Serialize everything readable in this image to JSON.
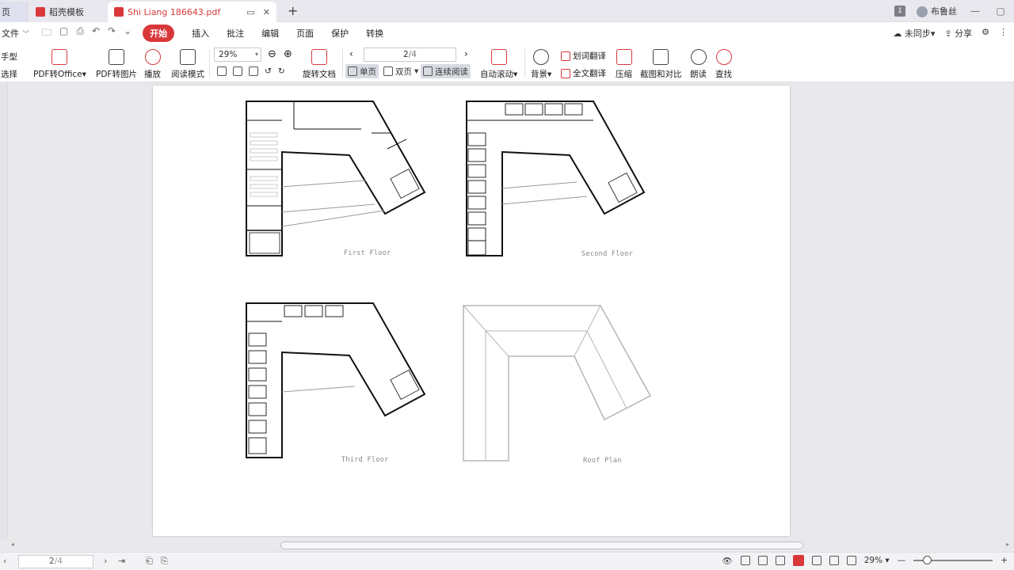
{
  "tabs": {
    "first": "页",
    "template": "稻壳模板",
    "document": "Shi Liang 186643.pdf"
  },
  "titlebar": {
    "badge": "1",
    "user": "布鲁丝"
  },
  "menu": {
    "file": "文件",
    "items": [
      "开始",
      "插入",
      "批注",
      "编辑",
      "页面",
      "保护",
      "转换"
    ],
    "sync": "未同步",
    "share": "分享"
  },
  "ribbon": {
    "hand_top": "手型",
    "hand_bottom": "选择",
    "pdf_to_office": "PDF转Office",
    "pdf_to_image": "PDF转图片",
    "play": "播放",
    "read_mode": "阅读模式",
    "zoom": "29%",
    "rotate": "旋转文档",
    "single": "单页",
    "double": "双页",
    "continuous": "连续阅读",
    "page_current": "2",
    "page_total": "/4",
    "auto_scroll": "自动滚动",
    "background": "背景",
    "word_translate": "划词翻译",
    "full_translate": "全文翻译",
    "compress": "压缩",
    "screenshot_compare": "截图和对比",
    "read_aloud": "朗读",
    "find": "查找"
  },
  "page_content": {
    "labels": [
      "First Floor",
      "Second Floor",
      "Third Floor",
      "Roof Plan"
    ]
  },
  "statusbar": {
    "page_current": "2",
    "page_total": "/4",
    "zoom": "29%"
  }
}
